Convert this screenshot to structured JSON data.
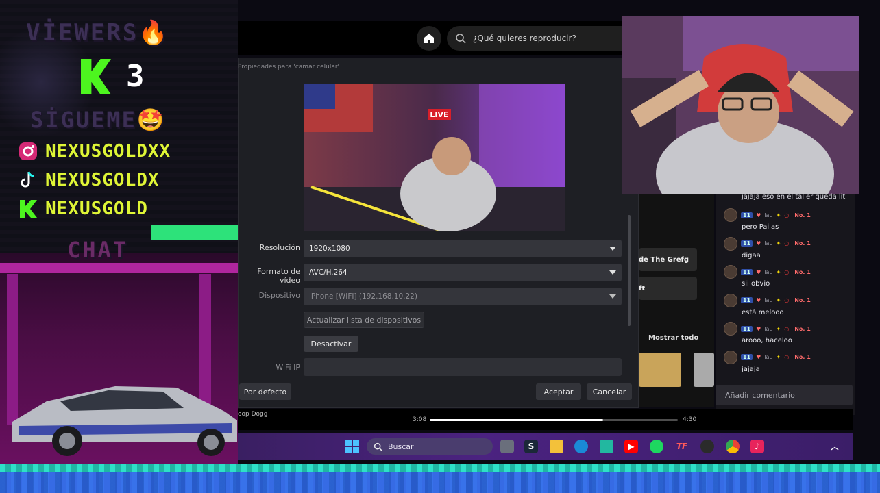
{
  "overlay": {
    "viewers_label": "VİEWERS🔥",
    "viewers_count": "3",
    "kick_letter": "K",
    "follow_label": "SİGUEME🤩",
    "socials": [
      {
        "platform_icon": "instagram-icon",
        "handle": "NEXUSGOLDXX"
      },
      {
        "platform_icon": "tiktok-icon",
        "handle": "NEXUSGOLDX"
      },
      {
        "platform_icon": "kick-icon",
        "handle": "NEXUSGOLD"
      }
    ],
    "chat_label": "CHAT"
  },
  "spotify": {
    "search_placeholder": "¿Qué quieres reproducir?",
    "middle_items": [
      "de The Grefg",
      "ft",
      "Mostrar todo"
    ],
    "track_artist": "oop Dogg",
    "time_elapsed": "3:08",
    "time_total": "4:30",
    "progress": 0.7
  },
  "dialog": {
    "title": "Propiedades para 'camar celular'",
    "preview_live_label": "LIVE",
    "resolution_label": "Resolución",
    "resolution_value": "1920x1080",
    "format_label": "Formato de vídeo",
    "format_value": "AVC/H.264",
    "device_label": "Dispositivo",
    "device_value": "iPhone [WIFI] (192.168.10.22)",
    "refresh_button": "Actualizar lista de dispositivos",
    "deactivate_button": "Desactivar",
    "wifi_label": "WiFi IP",
    "wifi_value": "",
    "defaults_button": "Por defecto",
    "accept_button": "Aceptar",
    "cancel_button": "Cancelar"
  },
  "chat": {
    "top_message": "jajaja eso en el taller queda lit",
    "badge_count": "11",
    "user": "lau",
    "rank": "No. 1",
    "messages": [
      "pero Pailas",
      "digaa",
      "sii obvio",
      "está melooo",
      "arooo, haceloo",
      "jajaja"
    ],
    "comment_placeholder": "Añadir comentario"
  },
  "taskbar": {
    "search_label": "Buscar",
    "icons": [
      "windows-icon",
      "search-icon",
      "task-view-icon",
      "steam-icon",
      "file-explorer-icon",
      "edge-icon",
      "store-icon",
      "youtube-icon",
      "spotify-icon",
      "tf-icon",
      "obs-icon",
      "chrome-icon",
      "tiktok-icon",
      "chevron-up-icon"
    ]
  },
  "colors": {
    "kick_green": "#4df51f",
    "social_yellow": "#dff536",
    "dialog_bg": "#1e1f24",
    "taskbar": "#3b1e68"
  }
}
